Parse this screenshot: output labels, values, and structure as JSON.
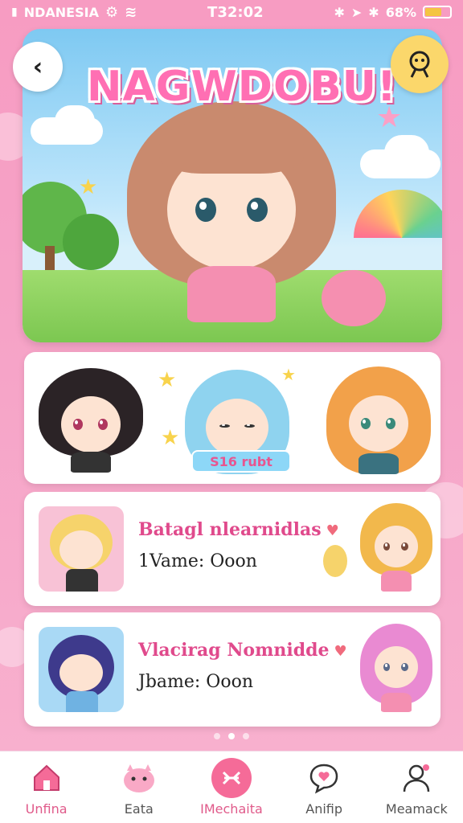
{
  "status_bar": {
    "carrier": "NDANESIA",
    "time": "T32:02",
    "battery": "68%",
    "battery_level": 0.68
  },
  "hero": {
    "title": "NAGWDOBU!"
  },
  "gallery": {
    "sticker_label": "S16 rubt"
  },
  "list": [
    {
      "name": "Batagl nlearnidlas",
      "subtitle": "1Vame: Ooon"
    },
    {
      "name": "Vlacirag Nomnidde",
      "subtitle": "Jbame: Ooon"
    }
  ],
  "pager": {
    "count": 3,
    "active": 1
  },
  "nav": {
    "items": [
      {
        "label": "Unfina",
        "icon": "home-icon"
      },
      {
        "label": "Eata",
        "icon": "pet-icon"
      },
      {
        "label": "IMechaita",
        "icon": "center-action-icon"
      },
      {
        "label": "Anifip",
        "icon": "chat-heart-icon"
      },
      {
        "label": "Meamack",
        "icon": "profile-icon"
      }
    ]
  },
  "colors": {
    "accent_pink": "#f56b98",
    "name_pink": "#e04a8c",
    "yellow": "#fbd76b"
  }
}
